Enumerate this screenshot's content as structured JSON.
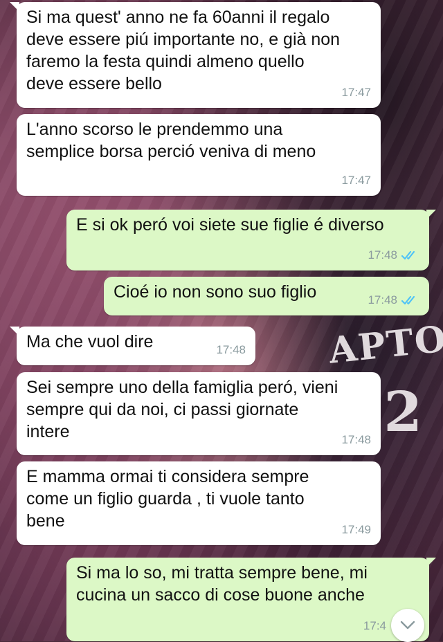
{
  "messages": [
    {
      "direction": "in",
      "text": "Si ma quest' anno ne fa 60anni il regalo\ndeve essere piú importante no, e già non\nfaremo la festa quindi almeno quello\ndeve essere bello",
      "time": "17:47"
    },
    {
      "direction": "in",
      "text": "L'anno scorso le prendemmo una\nsemplice borsa perció veniva di meno",
      "time": "17:47"
    },
    {
      "direction": "out",
      "text": "E si ok peró voi siete sue figlie é diverso",
      "time": "17:48",
      "status": "read"
    },
    {
      "direction": "out",
      "text": "Cioé io non sono suo figlio",
      "time": "17:48",
      "status": "read"
    },
    {
      "direction": "in",
      "text": "Ma che vuol dire",
      "time": "17:48"
    },
    {
      "direction": "in",
      "text": "Sei sempre uno della famiglia peró, vieni\nsempre qui da noi, ci passi giornate\nintere",
      "time": "17:48"
    },
    {
      "direction": "in",
      "text": "E mamma ormai ti considera sempre\ncome un figlio guarda , ti vuole tanto\nbene",
      "time": "17:49"
    },
    {
      "direction": "out",
      "text": "Si ma lo so, mi tratta sempre bene, mi\ncucina un sacco di cose buone anche",
      "time": "17:4",
      "status": "read"
    }
  ],
  "wallpaper": {
    "jersey_text": "APTO",
    "jersey_number": "2"
  },
  "colors": {
    "incoming_bubble": "#ffffff",
    "outgoing_bubble": "#dcf8c6",
    "read_ticks": "#4fc3f7",
    "timestamp": "#8a9a9e"
  },
  "icons": {
    "read_receipt": "double-check-icon",
    "scroll_down": "chevron-down-icon"
  }
}
